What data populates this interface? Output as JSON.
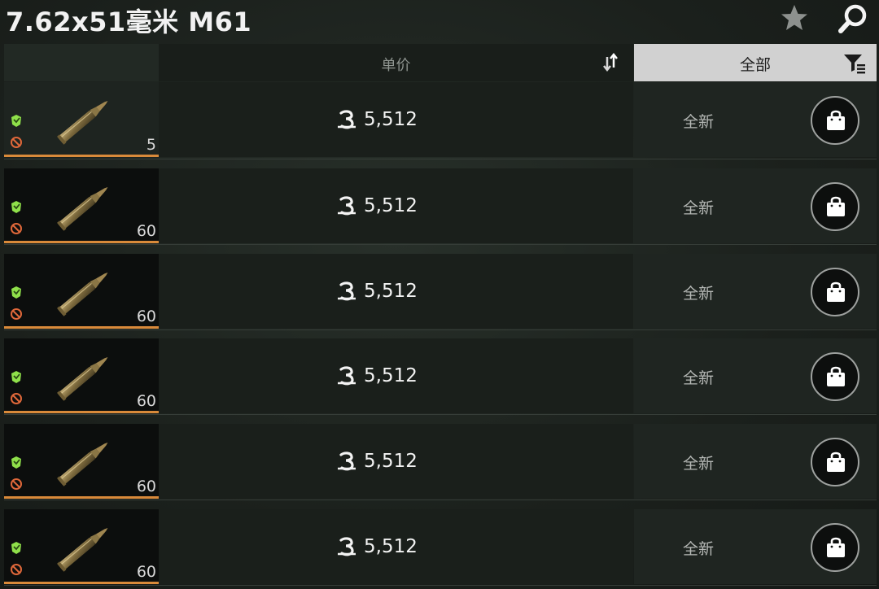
{
  "header": {
    "title": "7.62x51毫米 M61",
    "star_icon": "star-icon",
    "search_icon": "search-icon"
  },
  "columns": {
    "price_label": "单价",
    "filter_label": "全部",
    "sort_icon": "sort-arrows-icon",
    "filter_icon": "filter-list-icon"
  },
  "colors": {
    "accent_orange": "#d98a3a",
    "found_in_raid_green": "#8fe04a",
    "ban_red": "#e0683a"
  },
  "offers": [
    {
      "quantity": "5",
      "price": "5,512",
      "condition": "全新",
      "item_icon": "rifle-cartridge-icon"
    },
    {
      "quantity": "60",
      "price": "5,512",
      "condition": "全新",
      "item_icon": "rifle-cartridge-icon"
    },
    {
      "quantity": "60",
      "price": "5,512",
      "condition": "全新",
      "item_icon": "rifle-cartridge-icon"
    },
    {
      "quantity": "60",
      "price": "5,512",
      "condition": "全新",
      "item_icon": "rifle-cartridge-icon"
    },
    {
      "quantity": "60",
      "price": "5,512",
      "condition": "全新",
      "item_icon": "rifle-cartridge-icon"
    },
    {
      "quantity": "60",
      "price": "5,512",
      "condition": "全新",
      "item_icon": "rifle-cartridge-icon"
    }
  ]
}
